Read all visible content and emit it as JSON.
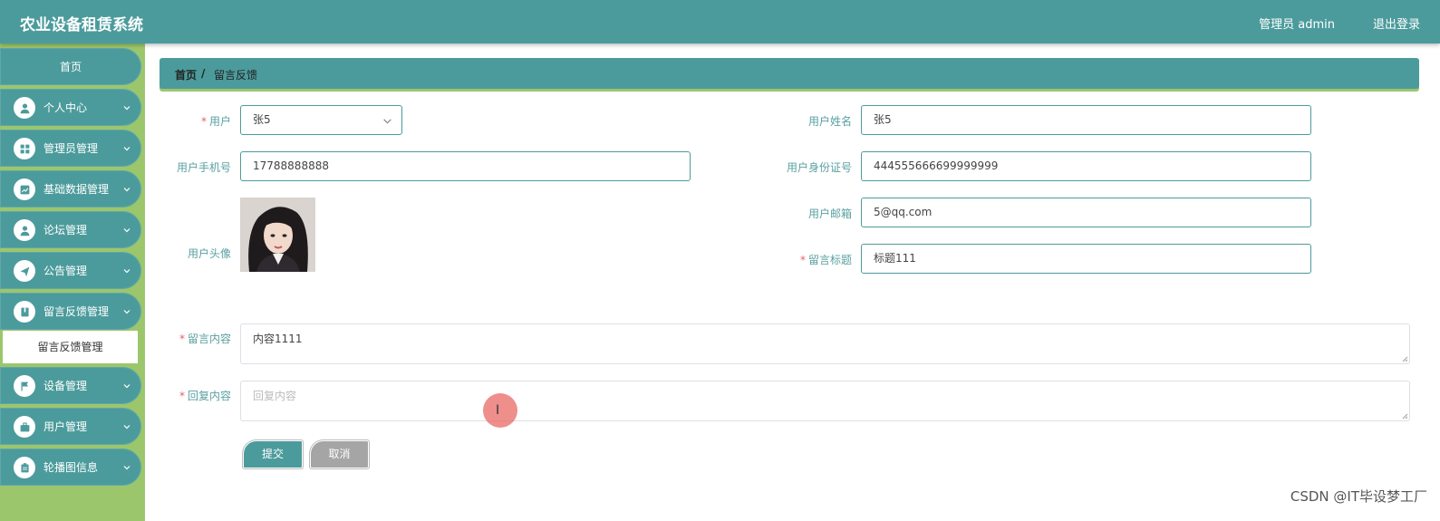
{
  "app": {
    "title": "农业设备租赁系统"
  },
  "topbar": {
    "user_label": "管理员 admin",
    "logout_label": "退出登录"
  },
  "sidebar": {
    "home_label": "首页",
    "items": [
      {
        "label": "个人中心",
        "icon": "user-icon"
      },
      {
        "label": "管理员管理",
        "icon": "grid-icon"
      },
      {
        "label": "基础数据管理",
        "icon": "chart-icon"
      },
      {
        "label": "论坛管理",
        "icon": "user-icon"
      },
      {
        "label": "公告管理",
        "icon": "send-icon"
      },
      {
        "label": "留言反馈管理",
        "icon": "book-icon"
      },
      {
        "label": "设备管理",
        "icon": "flag-icon"
      },
      {
        "label": "用户管理",
        "icon": "briefcase-icon"
      },
      {
        "label": "轮播图信息",
        "icon": "clipboard-icon"
      }
    ],
    "active_sub_label": "留言反馈管理"
  },
  "breadcrumb": {
    "home": "首页",
    "separator": "/",
    "current": "留言反馈"
  },
  "form": {
    "user": {
      "label": "用户",
      "value": "张5"
    },
    "user_name": {
      "label": "用户姓名",
      "value": "张5"
    },
    "user_phone": {
      "label": "用户手机号",
      "value": "17788888888"
    },
    "user_id_number": {
      "label": "用户身份证号",
      "value": "444555666699999999"
    },
    "user_email": {
      "label": "用户邮箱",
      "value": "5@qq.com"
    },
    "user_avatar": {
      "label": "用户头像"
    },
    "message_title": {
      "label": "留言标题",
      "value": "标题111"
    },
    "message_content": {
      "label": "留言内容",
      "value": "内容1111"
    },
    "reply_content": {
      "label": "回复内容",
      "placeholder": "回复内容"
    },
    "required_mark": "*",
    "submit_label": "提交",
    "cancel_label": "取消"
  },
  "watermark": "CSDN @IT毕设梦工厂",
  "colors": {
    "primary": "#4c9b9c",
    "sidebar_bg": "#9cc66c",
    "required": "#e6606b",
    "cancel": "#a5a5a5"
  }
}
